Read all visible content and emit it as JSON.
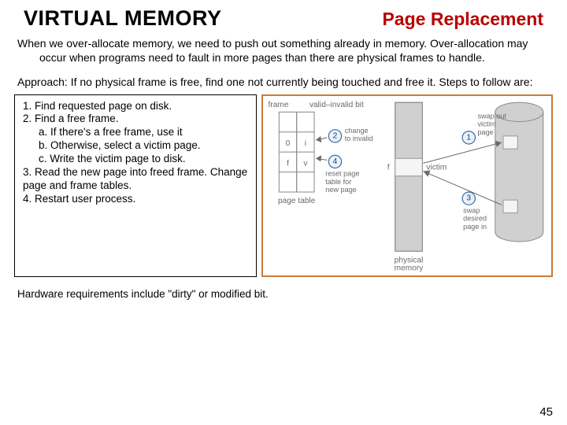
{
  "header": {
    "title": "VIRTUAL MEMORY",
    "subtitle": "Page Replacement"
  },
  "para1": "When we over-allocate memory, we need to push out something already in memory. Over-allocation may occur when programs need to fault in more pages than there are physical frames to handle.",
  "para2": "Approach: If no physical frame is free, find one not currently being touched and free it. Steps to follow are:",
  "steps": {
    "s1": "1. Find requested page on disk.",
    "s2": "2. Find a free frame.",
    "s2a": "a. If there's a free frame, use it",
    "s2b": "b. Otherwise, select a victim page.",
    "s2c": "c. Write the victim page to disk.",
    "s3": "3. Read the new page into freed frame.   Change page and frame tables.",
    "s4": "4. Restart user process."
  },
  "hw": "Hardware requirements include \"dirty\" or modified bit.",
  "pagenum": "45",
  "diagram": {
    "col_frame": "frame",
    "col_valid": "valid–invalid bit",
    "pt_label": "page table",
    "phys_label": "physical\nmemory",
    "row0_left": "0",
    "row0_right": "i",
    "row1_left": "f",
    "row1_right": "v",
    "chg": "change\nto invalid",
    "reset": "reset page\ntable for\nnew page",
    "victim_f": "f",
    "victim": "victim",
    "swap_out": "swap out\nvictim\npage",
    "swap_in": "swap\ndesired\npage in",
    "c1": "1",
    "c2": "2",
    "c3": "3",
    "c4": "4"
  }
}
